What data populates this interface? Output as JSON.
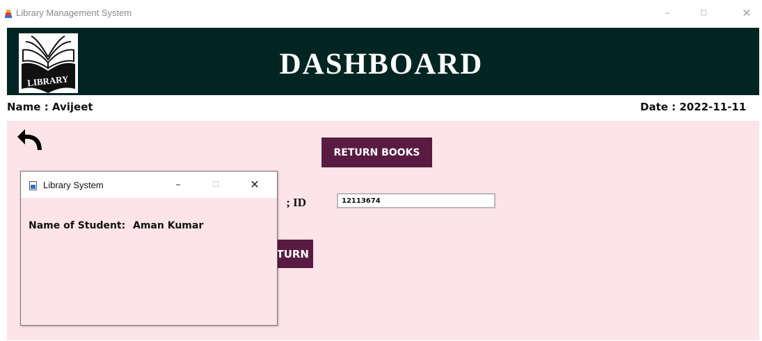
{
  "window": {
    "title": "Library Management System",
    "controls": {
      "minimize": "–",
      "maximize": "☐",
      "close": "✕"
    }
  },
  "header": {
    "logo_text": "LIBRARY",
    "title": "DASHBOARD"
  },
  "info": {
    "name_label": "Name :  Avijeet",
    "date_label": "Date :  2022-11-11"
  },
  "panel": {
    "back_icon": "back-arrow-icon",
    "return_books_button": "RETURN BOOKS",
    "reg_id_label": "; ID",
    "reg_id_value": "12113674",
    "return_button": "TURN"
  },
  "popup": {
    "title": "Library System",
    "controls": {
      "minimize": "–",
      "maximize": "☐",
      "close": "✕"
    },
    "student_label": "Name of Student:",
    "student_value": "Aman Kumar"
  },
  "colors": {
    "header_bg": "#012522",
    "panel_bg": "#fde4e9",
    "button_bg": "#5a1b42"
  }
}
